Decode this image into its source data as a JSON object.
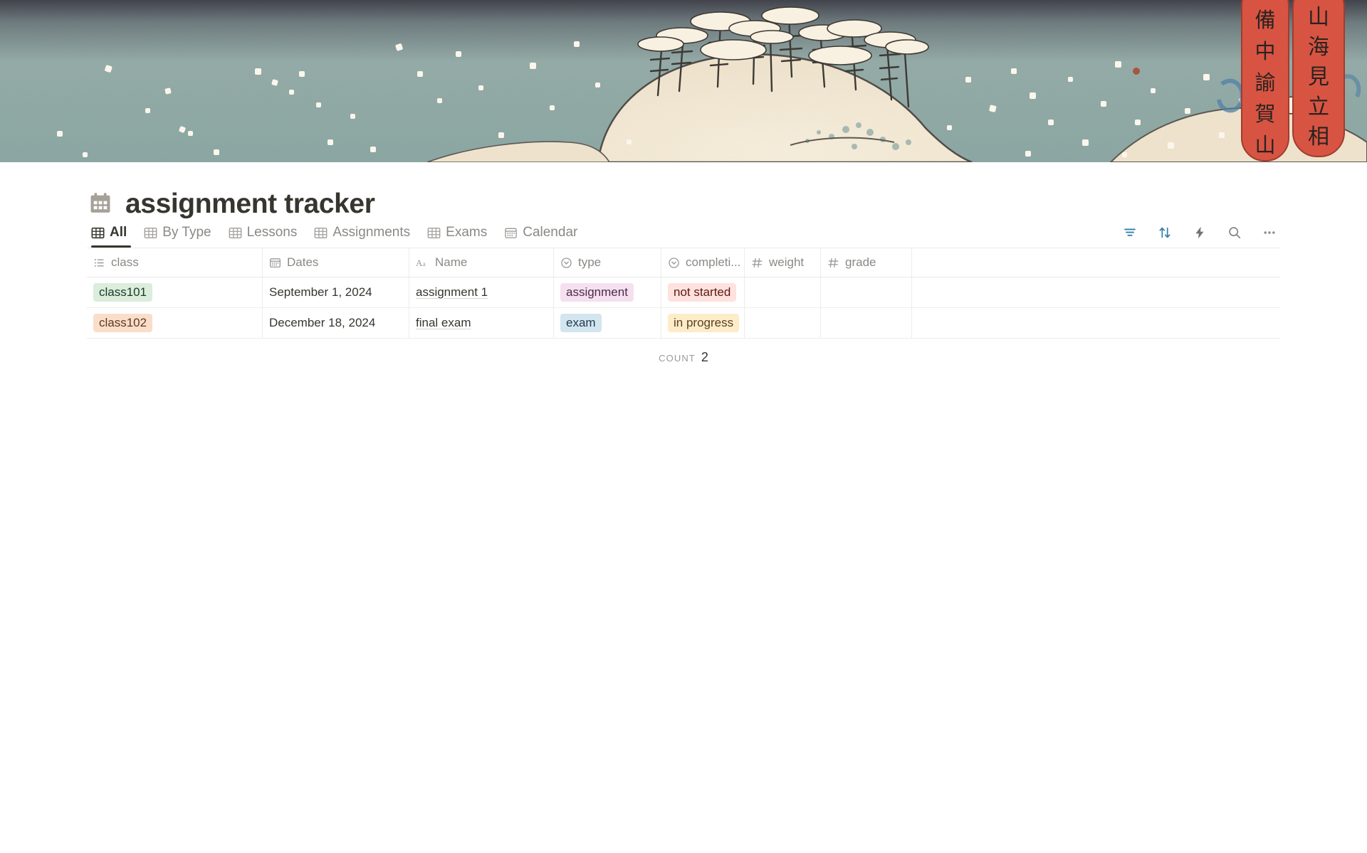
{
  "banner": {
    "name": "japanese-woodblock-snow-landscape-cover",
    "alt": "Hiroshige-style woodblock print: snow-covered hill with pine trees under a teal winter sky",
    "sky_top_color": "#4a4a55",
    "sky_color": "#8fada9",
    "snow_color": "#f4ead6",
    "cartouche_color": "#d9513f",
    "cartouche_right_text": "山海見立相撲",
    "cartouche_left_text": "備中諭賀山"
  },
  "page": {
    "icon": "calendar-icon",
    "title": "assignment tracker"
  },
  "views": {
    "tabs": [
      {
        "label": "All",
        "icon": "table-icon",
        "active": true
      },
      {
        "label": "By Type",
        "icon": "table-icon",
        "active": false
      },
      {
        "label": "Lessons",
        "icon": "table-icon",
        "active": false
      },
      {
        "label": "Assignments",
        "icon": "table-icon",
        "active": false
      },
      {
        "label": "Exams",
        "icon": "table-icon",
        "active": false
      },
      {
        "label": "Calendar",
        "icon": "calendar-icon",
        "active": false
      }
    ]
  },
  "toolbar": {
    "items": [
      {
        "name": "filter-icon",
        "label": "Filter",
        "color": "#337ea9"
      },
      {
        "name": "sort-icon",
        "label": "Sort",
        "color": "#337ea9"
      },
      {
        "name": "automation-icon",
        "label": "Automations",
        "color": "#8b8985"
      },
      {
        "name": "search-icon",
        "label": "Search",
        "color": "#8b8985"
      },
      {
        "name": "more-icon",
        "label": "More",
        "color": "#8b8985"
      }
    ]
  },
  "table": {
    "columns": [
      {
        "label": "class",
        "icon": "multi-select-icon"
      },
      {
        "label": "Dates",
        "icon": "calendar-icon"
      },
      {
        "label": "Name",
        "icon": "text-icon"
      },
      {
        "label": "type",
        "icon": "select-icon"
      },
      {
        "label": "completi...",
        "icon": "select-icon"
      },
      {
        "label": "weight",
        "icon": "number-icon"
      },
      {
        "label": "grade",
        "icon": "number-icon"
      },
      {
        "label": "",
        "icon": ""
      }
    ],
    "rows": [
      {
        "class": "class101",
        "class_color": "green",
        "dates": "September 1, 2024",
        "name": "assignment 1",
        "type": "assignment",
        "type_color": "pink",
        "completion": "not started",
        "completion_color": "red",
        "weight": "",
        "grade": ""
      },
      {
        "class": "class102",
        "class_color": "orange",
        "dates": "December 18, 2024",
        "name": "final exam",
        "type": "exam",
        "type_color": "blue",
        "completion": "in progress",
        "completion_color": "yellow",
        "weight": "",
        "grade": ""
      }
    ],
    "footer": {
      "count_label": "COUNT",
      "count_value": "2"
    }
  }
}
